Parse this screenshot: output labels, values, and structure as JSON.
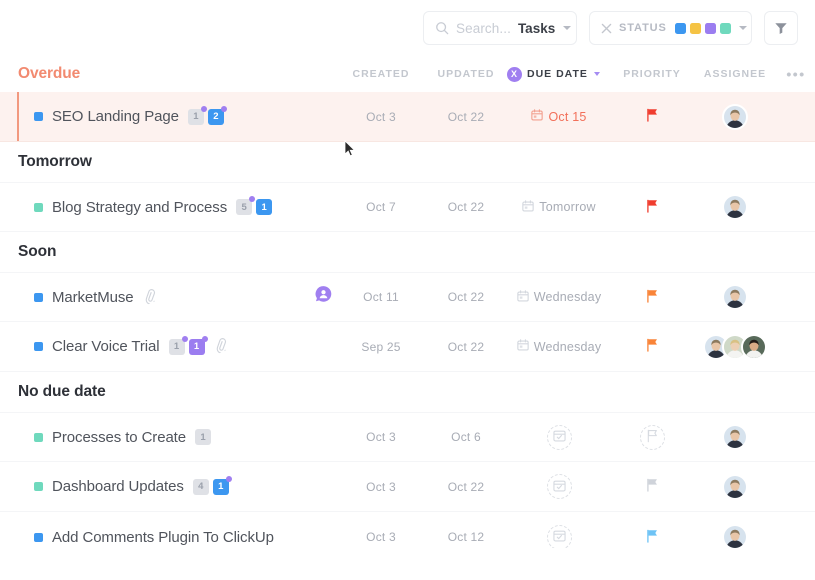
{
  "toolbar": {
    "search": {
      "placeholder": "Search...",
      "scope": "Tasks",
      "icon": "search-icon"
    },
    "status": {
      "label": "STATUS",
      "clear_icon": "close-icon",
      "swatches": [
        "#3c97f0",
        "#f5c344",
        "#9b7df0",
        "#6fd9bd"
      ]
    },
    "filter": {
      "icon": "filter-funnel-icon"
    }
  },
  "columns": {
    "created": "CREATED",
    "updated": "UPDATED",
    "due_date": "DUE DATE",
    "due_badge": "X",
    "priority": "PRIORITY",
    "assignee": "ASSIGNEE",
    "more": "•••"
  },
  "colors": {
    "overdue_heading": "#f28a70",
    "overdue_row_bg": "#fdf2ef",
    "overdue_accent": "#f2997f",
    "due_badge": "#a07ff0",
    "flag_red": "#f03d2f",
    "flag_orange": "#f98438",
    "flag_gray": "#cfd3da",
    "flag_blue": "#6ec3f5",
    "status_blue": "#3c97f0",
    "status_teal": "#6fd9bd"
  },
  "groups": [
    {
      "title": "Overdue",
      "variant": "overdue",
      "tasks": [
        {
          "name": "SEO Landing Page",
          "status_color": "#3c97f0",
          "badges": [
            {
              "text": "1",
              "style": "gray",
              "dot": true
            },
            {
              "text": "2",
              "style": "blue",
              "dot": true
            }
          ],
          "clip": false,
          "mention": false,
          "created": "Oct 3",
          "updated": "Oct 22",
          "due": "Oct 15",
          "due_overdue": true,
          "priority_flag": "red",
          "avatars": 1
        }
      ]
    },
    {
      "title": "Tomorrow",
      "variant": "normal",
      "tasks": [
        {
          "name": "Blog Strategy and Process",
          "status_color": "#6fd9bd",
          "badges": [
            {
              "text": "5",
              "style": "gray",
              "dot": true
            },
            {
              "text": "1",
              "style": "blue",
              "dot": false
            }
          ],
          "clip": false,
          "mention": false,
          "created": "Oct 7",
          "updated": "Oct 22",
          "due": "Tomorrow",
          "due_overdue": false,
          "priority_flag": "red",
          "avatars": 1
        }
      ]
    },
    {
      "title": "Soon",
      "variant": "normal",
      "tasks": [
        {
          "name": "MarketMuse",
          "status_color": "#3c97f0",
          "badges": [],
          "clip": true,
          "mention": true,
          "created": "Oct 11",
          "updated": "Oct 22",
          "due": "Wednesday",
          "due_overdue": false,
          "priority_flag": "orange",
          "avatars": 1
        },
        {
          "name": "Clear Voice Trial",
          "status_color": "#3c97f0",
          "badges": [
            {
              "text": "1",
              "style": "gray",
              "dot": true
            },
            {
              "text": "1",
              "style": "purple",
              "dot": true
            }
          ],
          "clip": true,
          "mention": false,
          "created": "Sep 25",
          "updated": "Oct 22",
          "due": "Wednesday",
          "due_overdue": false,
          "priority_flag": "orange",
          "avatars": 3
        }
      ]
    },
    {
      "title": "No due date",
      "variant": "normal",
      "tasks": [
        {
          "name": "Processes to Create",
          "status_color": "#6fd9bd",
          "badges": [
            {
              "text": "1",
              "style": "gray",
              "dot": false
            }
          ],
          "clip": false,
          "mention": false,
          "created": "Oct 3",
          "updated": "Oct 6",
          "due": "",
          "due_overdue": false,
          "priority_flag": "empty",
          "avatars": 1
        },
        {
          "name": "Dashboard Updates",
          "status_color": "#6fd9bd",
          "badges": [
            {
              "text": "4",
              "style": "gray",
              "dot": false
            },
            {
              "text": "1",
              "style": "blue",
              "dot": true
            }
          ],
          "clip": false,
          "mention": false,
          "created": "Oct 3",
          "updated": "Oct 22",
          "due": "",
          "due_overdue": false,
          "priority_flag": "gray",
          "avatars": 1
        },
        {
          "name": "Add Comments Plugin To ClickUp",
          "status_color": "#3c97f0",
          "badges": [],
          "clip": false,
          "mention": false,
          "created": "Oct 3",
          "updated": "Oct 12",
          "due": "",
          "due_overdue": false,
          "priority_flag": "blue",
          "avatars": 1,
          "clipped": true
        }
      ]
    }
  ]
}
